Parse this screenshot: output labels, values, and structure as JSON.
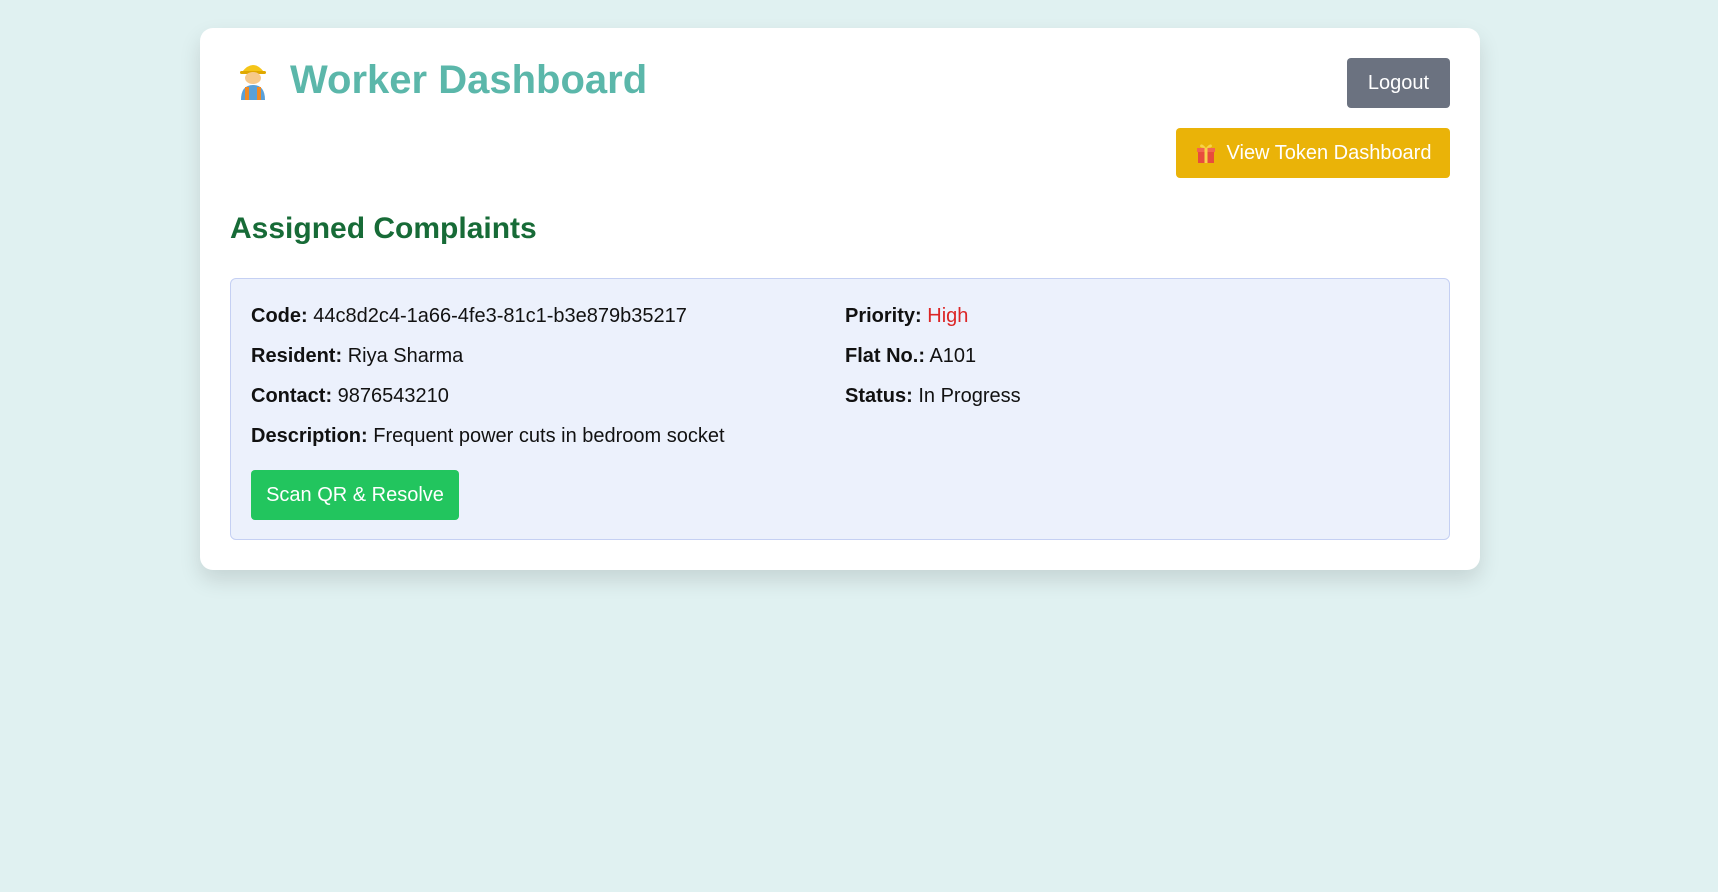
{
  "header": {
    "title": "Worker Dashboard",
    "icon": "construction-worker-icon",
    "logout_label": "Logout",
    "token_label": "View Token Dashboard",
    "token_icon": "gift-icon"
  },
  "section": {
    "title": "Assigned Complaints"
  },
  "complaints": [
    {
      "code_label": "Code:",
      "code": "44c8d2c4-1a66-4fe3-81c1-b3e879b35217",
      "resident_label": "Resident:",
      "resident": "Riya Sharma",
      "contact_label": "Contact:",
      "contact": "9876543210",
      "description_label": "Description:",
      "description": "Frequent power cuts in bedroom socket",
      "priority_label": "Priority:",
      "priority": "High",
      "flat_label": "Flat No.:",
      "flat": "A101",
      "status_label": "Status:",
      "status": "In Progress",
      "action_label": "Scan QR & Resolve"
    }
  ],
  "colors": {
    "background": "#e0f1f1",
    "title": "#5bb7aa",
    "section_title": "#176b37",
    "logout": "#6b7280",
    "token": "#eab308",
    "resolve": "#22c55e",
    "priority_high": "#dc2626"
  }
}
